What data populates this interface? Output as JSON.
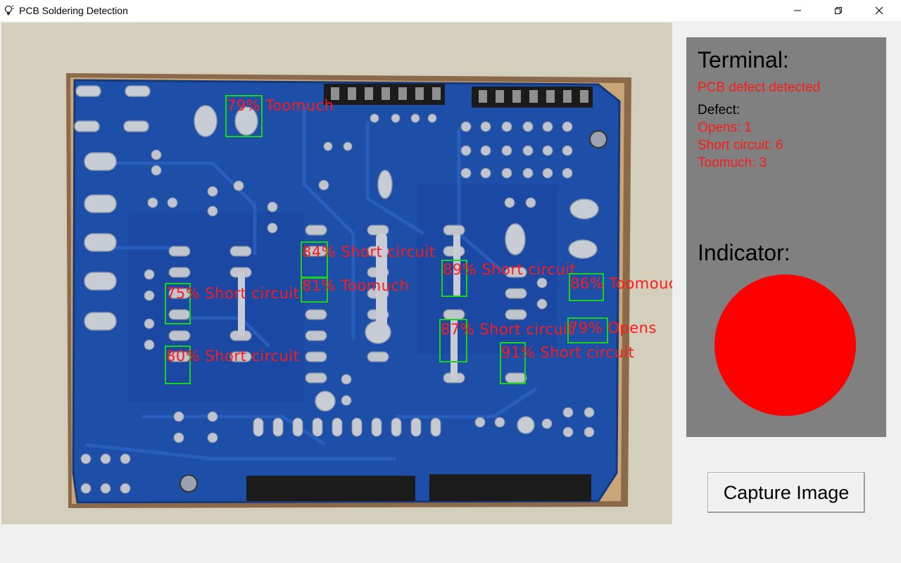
{
  "window": {
    "title": "PCB Soldering Detection",
    "icon": "lightbulb-icon",
    "controls": [
      "minimize-icon",
      "maximize-icon",
      "close-icon"
    ]
  },
  "detections": [
    {
      "label": "79% Toomuch"
    },
    {
      "label": "84% Short circuit"
    },
    {
      "label": "81% Toomuch"
    },
    {
      "label": "89% Short circuit"
    },
    {
      "label": "86% Toomouc"
    },
    {
      "label": "75% Short circuit"
    },
    {
      "label": "87% Short circuit"
    },
    {
      "label": "79% Opens"
    },
    {
      "label": "80% Short circuit"
    },
    {
      "label": "91% Short circuit"
    }
  ],
  "terminal": {
    "heading": "Terminal:",
    "status": "PCB defect detected",
    "defect_heading": "Defect:",
    "defects": [
      "Opens: 1",
      "Short circuit: 6",
      "Toomuch: 3"
    ]
  },
  "indicator": {
    "heading": "Indicator:",
    "color": "#ff0000"
  },
  "actions": {
    "capture_label": "Capture Image"
  },
  "colors": {
    "box": "#19d419",
    "label": "#ff1a1a",
    "panel": "#808080"
  }
}
